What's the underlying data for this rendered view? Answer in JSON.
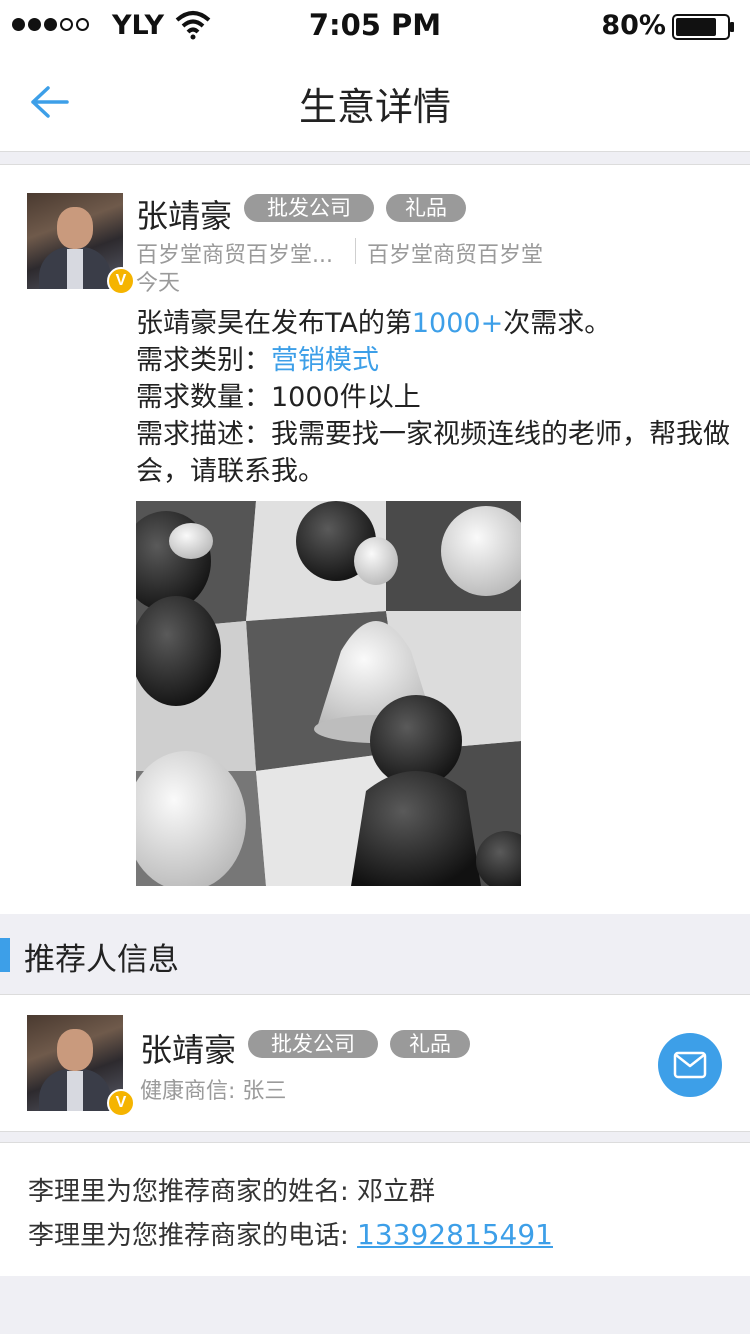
{
  "status_bar": {
    "carrier": "YLY",
    "time": "7:05 PM",
    "battery": "80%",
    "battery_level": 0.8,
    "signal_bars_filled": 3,
    "signal_bars_total": 5
  },
  "nav": {
    "title": "生意详情",
    "back_icon": "arrow-left-icon"
  },
  "post": {
    "author": "张靖豪",
    "tags": [
      "批发公司",
      "礼品"
    ],
    "company_short": "百岁堂商贸百岁堂...",
    "company_full": "百岁堂商贸百岁堂",
    "date": "今天",
    "line1_prefix": "张靖豪昊在发布TA的第",
    "line1_count": "1000+",
    "line1_suffix": "次需求。",
    "category_label": "需求类别：",
    "category_value": "营销模式",
    "quantity_label": "需求数量：",
    "quantity_value": "1000件以上",
    "desc_label": "需求描述：",
    "desc_value": "我需要找一家视频连线的老师，帮我做会，请联系我。",
    "verified_badge": "V"
  },
  "recommender_section": {
    "title": "推荐人信息"
  },
  "recommender": {
    "name": "张靖豪",
    "tags": [
      "批发公司",
      "礼品"
    ],
    "credit_label": "健康商信:",
    "credit_value": "张三",
    "verified_badge": "V",
    "mail_icon": "mail-icon"
  },
  "info": {
    "name_label": "李理里为您推荐商家的姓名:",
    "name_value": "邓立群",
    "phone_label": "李理里为您推荐商家的电话:",
    "phone_value": "13392815491"
  },
  "colors": {
    "accent": "#3d9fe8",
    "tag_bg": "#9a9a9a",
    "badge": "#f5b400",
    "page_bg": "#efeff4"
  }
}
